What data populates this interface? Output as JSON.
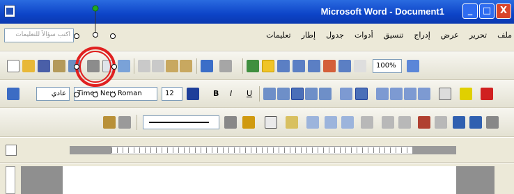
{
  "window": {
    "title": "Microsoft Word - Document1",
    "buttons": {
      "minimize": "_",
      "maximize": "□",
      "close": "X"
    }
  },
  "menubar": {
    "ask_placeholder": "اكتب سؤالاً للتعليمات",
    "items": [
      "ملف",
      "تحرير",
      "عرض",
      "إدراج",
      "تنسيق",
      "أدوات",
      "جدول",
      "إطار",
      "تعليمات"
    ]
  },
  "standard_toolbar": {
    "zoom": "100%"
  },
  "formatting_toolbar": {
    "style": "عادي",
    "font": "Times New Roman",
    "size": "12",
    "bold": "B",
    "italic": "I",
    "underline": "U"
  },
  "colors": {
    "titlebar": "#0d44c8",
    "highlight_ring": "#e02020",
    "selection_handle": "#22aa22"
  }
}
